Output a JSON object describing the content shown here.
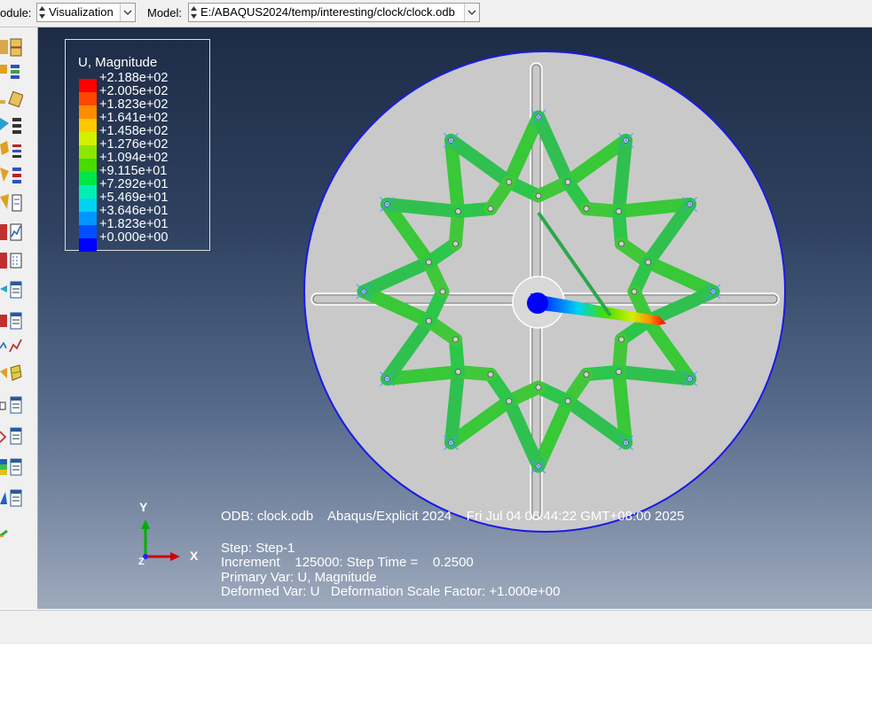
{
  "context_bar": {
    "module_label": "odule:",
    "module_value": "Visualization",
    "model_label": "Model:",
    "model_value": "E:/ABAQUS2024/temp/interesting/clock/clock.odb"
  },
  "legend": {
    "title": "U, Magnitude",
    "entries": [
      {
        "label": "+2.188e+02",
        "color": "#ff0000"
      },
      {
        "label": "+2.005e+02",
        "color": "#ff4600"
      },
      {
        "label": "+1.823e+02",
        "color": "#ff8c00"
      },
      {
        "label": "+1.641e+02",
        "color": "#ffc800"
      },
      {
        "label": "+1.458e+02",
        "color": "#d2f000"
      },
      {
        "label": "+1.276e+02",
        "color": "#8ce600"
      },
      {
        "label": "+1.094e+02",
        "color": "#46dc00"
      },
      {
        "label": "+9.115e+01",
        "color": "#00e646"
      },
      {
        "label": "+7.292e+01",
        "color": "#00f0b4"
      },
      {
        "label": "+5.469e+01",
        "color": "#00d2f0"
      },
      {
        "label": "+3.646e+01",
        "color": "#0096ff"
      },
      {
        "label": "+1.823e+01",
        "color": "#0050ff"
      },
      {
        "label": "+0.000e+00",
        "color": "#0000ff"
      }
    ]
  },
  "info": {
    "odb_line": "ODB: clock.odb    Abaqus/Explicit 2024    Fri Jul 04 06:44:22 GMT+08:00 2025",
    "step_line": "Step: Step-1",
    "increment_line": "Increment    125000: Step Time =    0.2500",
    "primary_var_line": "Primary Var: U, Magnitude",
    "deformed_var_line": "Deformed Var: U   Deformation Scale Factor: +1.000e+00"
  },
  "triad": {
    "y_label": "Y",
    "x_label": "X",
    "z_label": "Z"
  },
  "colors": {
    "viewport_top": "#1d2b46",
    "viewport_bottom": "#9eaabd",
    "disk": "#c8c8c8",
    "disk_edge": "#2020e0"
  }
}
